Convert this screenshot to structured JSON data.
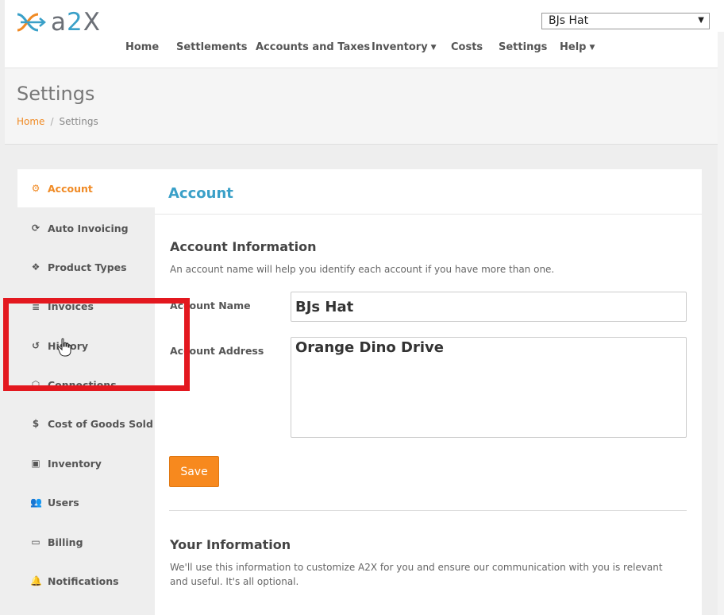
{
  "header": {
    "logo_text_a": "a",
    "logo_text_two": "2",
    "logo_text_x": "X",
    "account_selector": {
      "value": "BJs Hat"
    },
    "nav": [
      {
        "label": "Home"
      },
      {
        "label": "Settlements"
      },
      {
        "label": "Accounts and Taxes"
      },
      {
        "label": "Inventory",
        "dropdown": true
      },
      {
        "label": "Costs"
      },
      {
        "label": "Settings"
      },
      {
        "label": "Help",
        "dropdown": true
      }
    ]
  },
  "page": {
    "title": "Settings",
    "breadcrumb": {
      "home": "Home",
      "sep": "/",
      "current": "Settings"
    }
  },
  "sidebar": {
    "items": [
      {
        "label": "Account",
        "icon": "gears-icon",
        "active": true
      },
      {
        "label": "Auto Invoicing",
        "icon": "refresh-icon"
      },
      {
        "label": "Product Types",
        "icon": "cubes-icon"
      },
      {
        "label": "Invoices",
        "icon": "database-icon"
      },
      {
        "label": "History",
        "icon": "history-icon"
      },
      {
        "label": "Connections",
        "icon": "plug-icon"
      },
      {
        "label": "Cost of Goods Sold",
        "icon": "dollar-icon"
      },
      {
        "label": "Inventory",
        "icon": "archive-icon"
      },
      {
        "label": "Users",
        "icon": "users-icon"
      },
      {
        "label": "Billing",
        "icon": "credit-card-icon"
      },
      {
        "label": "Notifications",
        "icon": "bell-icon"
      }
    ]
  },
  "main": {
    "title": "Account",
    "account_info": {
      "heading": "Account Information",
      "description": "An account name will help you identify each account if you have more than one.",
      "name_label": "Account Name",
      "name_value": "BJs Hat",
      "address_label": "Account Address",
      "address_value": "Orange Dino Drive",
      "save_label": "Save"
    },
    "your_info": {
      "heading": "Your Information",
      "description": "We'll use this information to customize A2X for you and ensure our communication with you is relevant and useful. It's all optional."
    }
  },
  "colors": {
    "brand_orange": "#f7891e",
    "brand_blue": "#3aa0c8",
    "highlight_red": "#e3181f"
  }
}
